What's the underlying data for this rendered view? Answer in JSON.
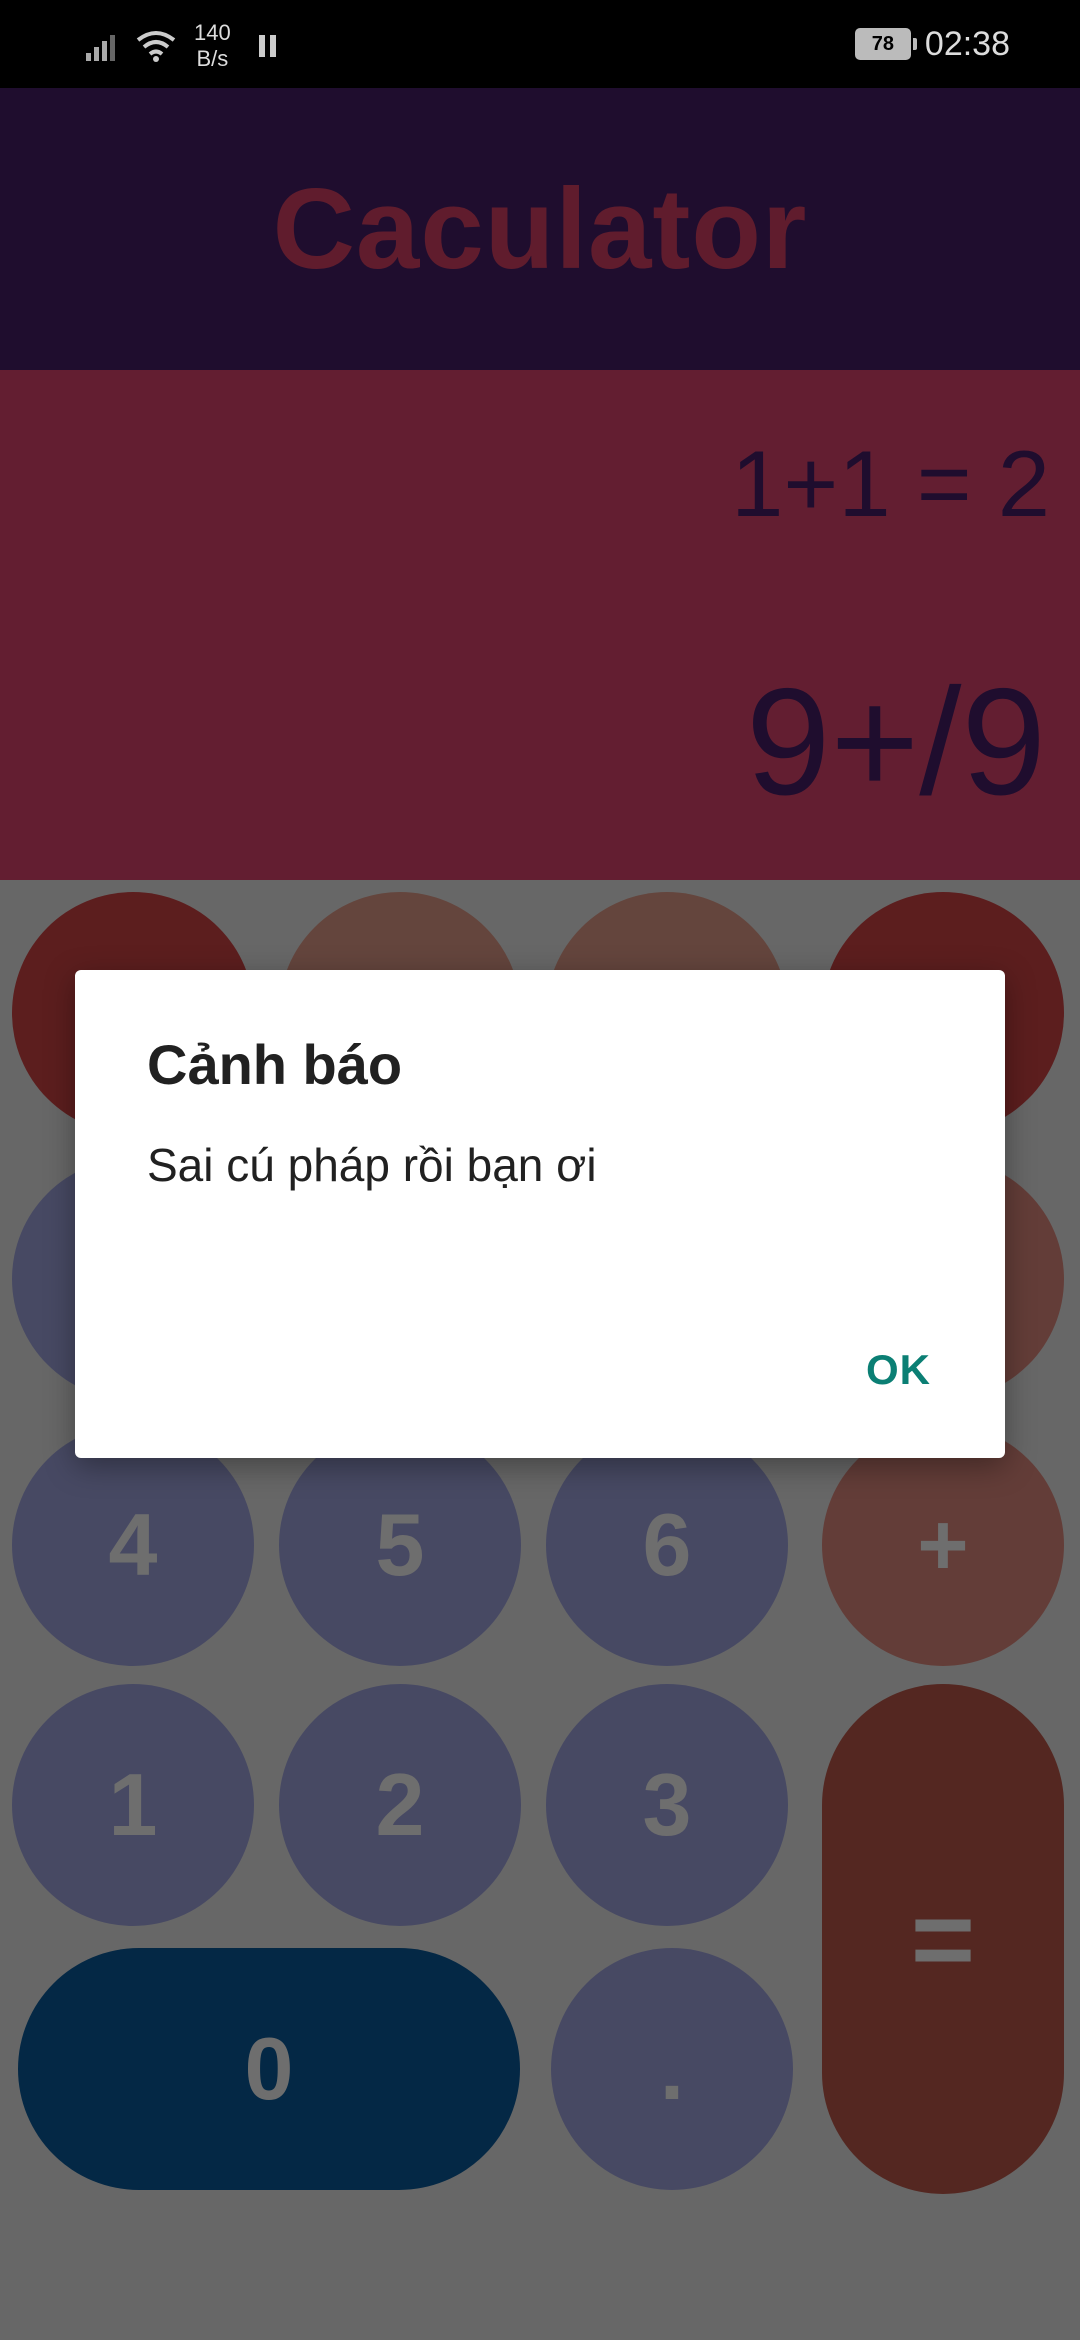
{
  "status_bar": {
    "net_speed_value": "140",
    "net_speed_unit": "B/s",
    "battery_level": "78",
    "time": "02:38"
  },
  "app": {
    "title": "Caculator"
  },
  "display": {
    "history": "1+1 = 2",
    "expression": "9+/9"
  },
  "keypad": {
    "row4": [
      "4",
      "5",
      "6",
      "+"
    ],
    "row5": [
      "1",
      "2",
      "3"
    ],
    "zero": "0",
    "dot": ".",
    "equals": "="
  },
  "dialog": {
    "title": "Cảnh báo",
    "message": "Sai cú pháp rồi bạn ơi",
    "ok_label": "OK"
  },
  "colors": {
    "header_bg": "#3e1b5c",
    "display_bg": "#c73d63",
    "number_key": "#8f93c7",
    "operator_key": "#c77a70",
    "zero_key": "#08508a",
    "dialog_accent": "#0b7f74"
  }
}
